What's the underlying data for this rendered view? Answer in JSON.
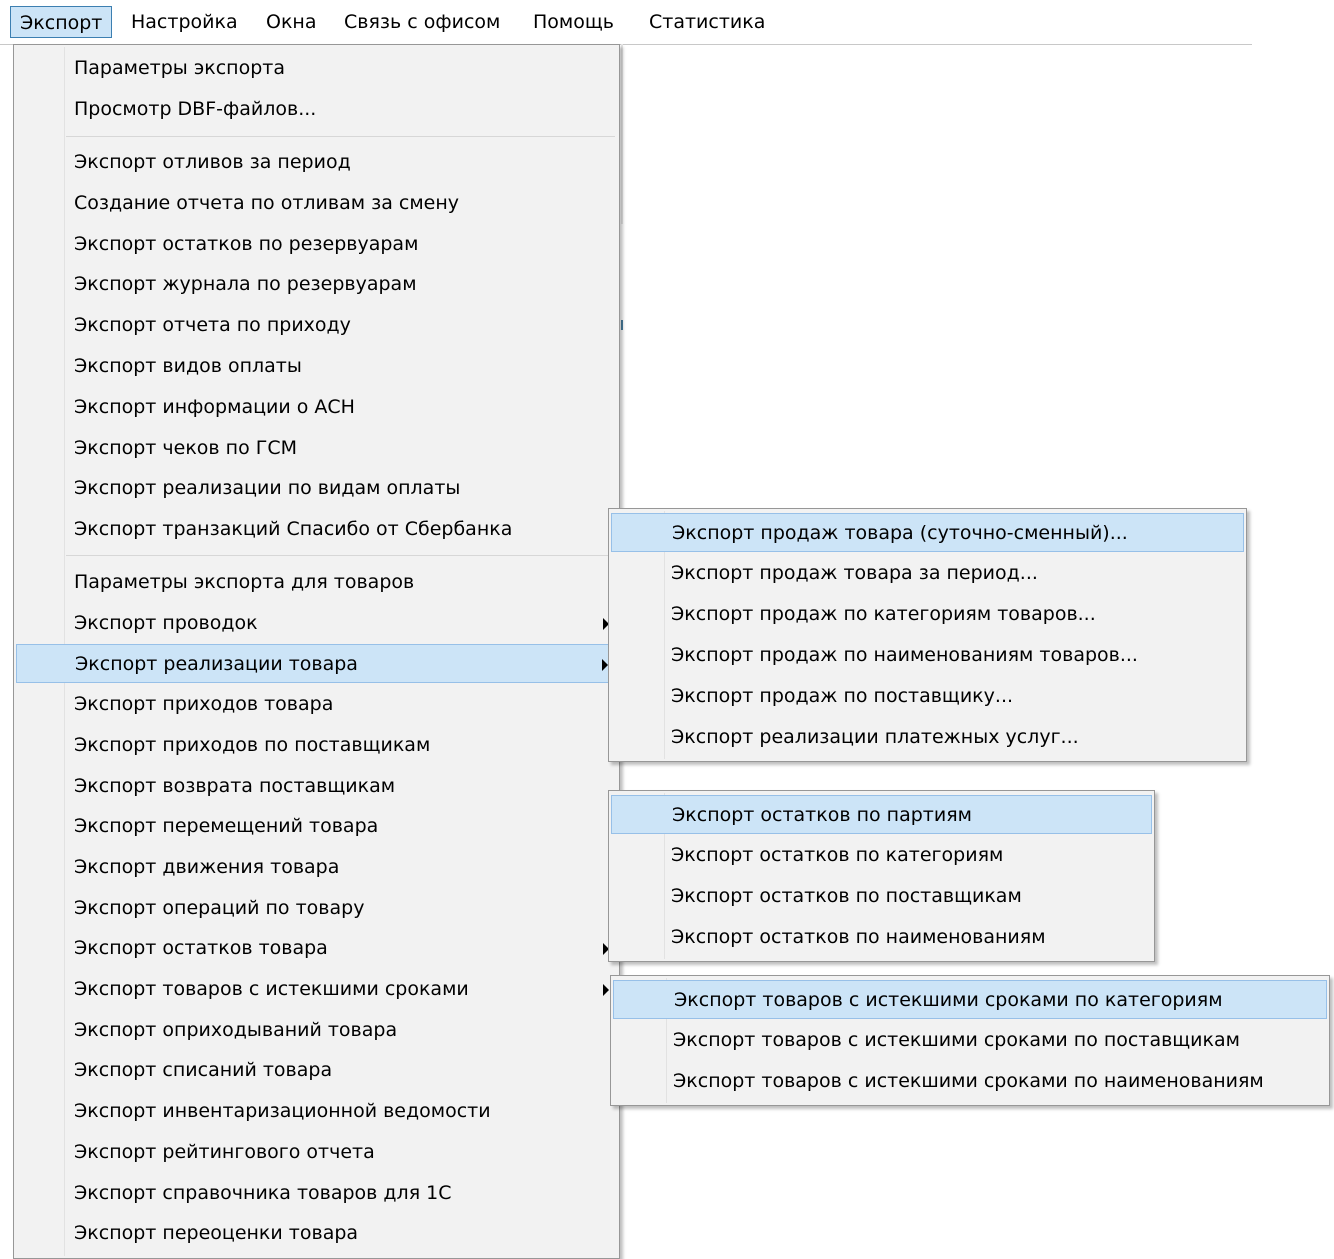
{
  "menubar": {
    "items": [
      "Экспорт",
      "Настройка",
      "Окна",
      "Связь с офисом",
      "Помощь",
      "Статистика"
    ]
  },
  "main_menu": {
    "items": [
      "Параметры экспорта",
      "Просмотр DBF-файлов...",
      "Экспорт отливов за период",
      "Создание отчета по отливам за смену",
      "Экспорт остатков по резервуарам",
      "Экспорт журнала по резервуарам",
      "Экспорт отчета по приходу",
      "Экспорт видов оплаты",
      "Экспорт информации о АСН",
      "Экспорт чеков по ГСМ",
      "Экспорт реализации по видам оплаты",
      "Экспорт транзакций Спасибо от Сбербанка",
      "Параметры экспорта для товаров",
      "Экспорт проводок",
      "Экспорт реализации товара",
      "Экспорт приходов товара",
      "Экспорт приходов по поставщикам",
      "Экспорт возврата поставщикам",
      "Экспорт перемещений товара",
      "Экспорт движения товара",
      "Экспорт операций по товару",
      "Экспорт остатков товара",
      "Экспорт товаров с истекшими сроками",
      "Экспорт оприходываний товара",
      "Экспорт списаний товара",
      "Экспорт инвентаризационной ведомости",
      "Экспорт рейтингового отчета",
      "Экспорт справочника товаров для 1С",
      "Экспорт переоценки товара"
    ]
  },
  "sales_submenu": {
    "items": [
      "Экспорт продаж товара (суточно-сменный)...",
      "Экспорт продаж товара за период...",
      "Экспорт продаж по категориям товаров...",
      "Экспорт продаж по наименованиям товаров...",
      "Экспорт продаж по поставщику...",
      "Экспорт реализации платежных услуг..."
    ]
  },
  "stock_submenu": {
    "items": [
      "Экспорт остатков по партиям",
      "Экспорт остатков по категориям",
      "Экспорт остатков по поставщикам",
      "Экспорт остатков по наименованиям"
    ]
  },
  "expired_submenu": {
    "items": [
      "Экспорт товаров с истекшими сроками по категориям",
      "Экспорт товаров с истекшими сроками по поставщикам",
      "Экспорт товаров с истекшими сроками по наименованиям"
    ]
  },
  "colors": {
    "highlight": "#cce4f7",
    "highlight_border": "#97c0e8",
    "menu_bg": "#f2f2f2"
  }
}
